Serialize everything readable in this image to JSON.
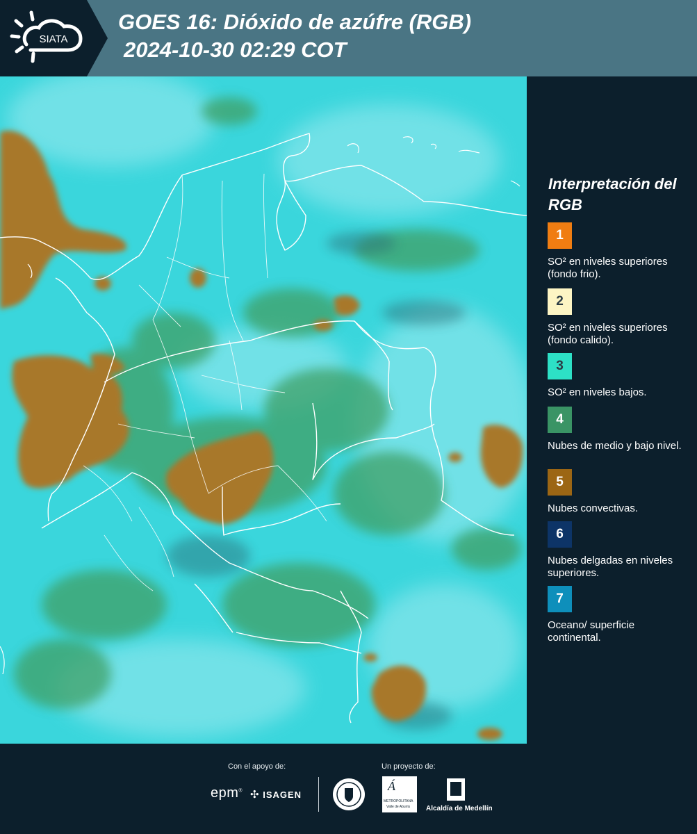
{
  "header": {
    "logo_text": "SIATA",
    "title_line1": "GOES 16: Dióxido de azúfre (RGB)",
    "title_line2": "2024-10-30 02:29 COT",
    "background_color": "#4a7584"
  },
  "map": {
    "background_color": "#3ad6dc",
    "cloud_colors": {
      "convective": "#a8782c",
      "low_mid": "#3fa066",
      "surface": "#3ad6dc"
    }
  },
  "legend": {
    "title": "Interpretación del RGB",
    "items": [
      {
        "number": "1",
        "color": "#f07d12",
        "label": "SO² en niveles superiores (fondo frio)."
      },
      {
        "number": "2",
        "color": "#fdf5c4",
        "label": "SO² en niveles superiores (fondo calido)."
      },
      {
        "number": "3",
        "color": "#2de0c6",
        "label": "SO² en niveles bajos."
      },
      {
        "number": "4",
        "color": "#3a9465",
        "label": "Nubes de medio y bajo nivel."
      },
      {
        "number": "5",
        "color": "#9c6614",
        "label": "Nubes convectivas."
      },
      {
        "number": "6",
        "color": "#0d3467",
        "label": "Nubes delgadas en niveles superiores."
      },
      {
        "number": "7",
        "color": "#0e8fbb",
        "label": "Oceano/ superficie continental."
      }
    ]
  },
  "footer": {
    "support_caption": "Con el apoyo de:",
    "project_caption": "Un proyecto de:",
    "sponsors": {
      "epm": "epm",
      "isagen": "ISAGEN",
      "metropolitana_line1": "METROPOLITANA",
      "metropolitana_line2": "Valle de Aburrá",
      "alcaldia": "Alcaldía de Medellín"
    }
  }
}
